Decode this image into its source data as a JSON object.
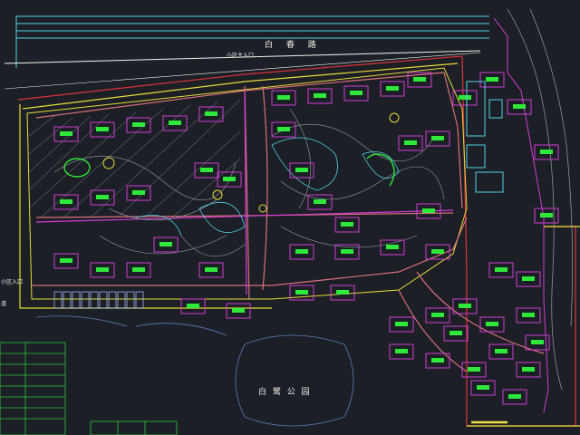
{
  "drawing": {
    "road_label": "白 春 路",
    "park_label": "白 鹭 公 园",
    "entrance_label": "小区主入口",
    "side_label_top": "小区入口",
    "side_label_bottom": "道",
    "colors": {
      "background": "#1c1f26",
      "road_cyan": "#4fd6e8",
      "boundary_red": "#e0323a",
      "boundary_yellow": "#e8dc3a",
      "building_magenta": "#d23cd6",
      "label_green": "#2ee83a",
      "curve_pink": "#d9707a",
      "path_grey": "#9aa0a8",
      "water_blue": "#5a7ec0",
      "frame_yellow": "#f0e040",
      "table_green": "#2ec83a",
      "white": "#f2f2f2"
    }
  }
}
